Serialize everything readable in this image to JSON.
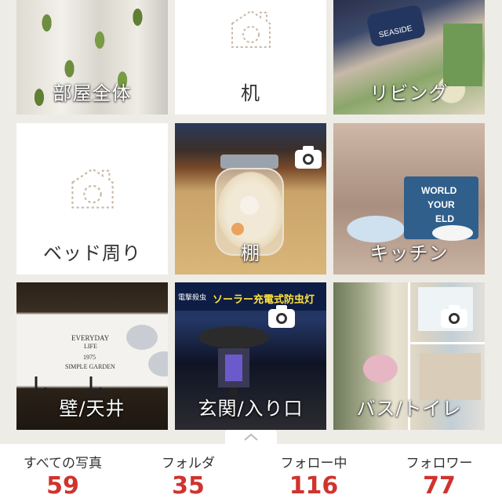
{
  "folders": [
    {
      "label": "部屋全体",
      "photo": true,
      "icon": "photo"
    },
    {
      "label": "机",
      "photo": false,
      "icon": "placeholder-camera-icon"
    },
    {
      "label": "リビング",
      "photo": true,
      "icon": "photo"
    },
    {
      "label": "ベッド周り",
      "photo": false,
      "icon": "placeholder-camera-icon"
    },
    {
      "label": "棚",
      "photo": true,
      "icon": "camera-icon"
    },
    {
      "label": "キッチン",
      "photo": true,
      "icon": "photo"
    },
    {
      "label": "壁/天井",
      "photo": true,
      "icon": "photo"
    },
    {
      "label": "玄関/入り口",
      "photo": true,
      "icon": "camera-icon"
    },
    {
      "label": "バス/トイレ",
      "photo": true,
      "icon": "camera-icon"
    }
  ],
  "photo_text": {
    "pillow": "SEASIDE",
    "sign_line1": "WORLD",
    "sign_line2": "YOUR",
    "sign_line3": "ELD",
    "hook_board_top": "EVERYDAY",
    "hook_board_top2": "LIFE",
    "hook_board_year": "1975",
    "hook_board_bottom": "SIMPLE GARDEN",
    "product_title": "ソーラー充電式防虫灯",
    "product_side": "電撃殺虫"
  },
  "stats": [
    {
      "name": "すべての写真",
      "value": "59"
    },
    {
      "name": "フォルダ",
      "value": "35"
    },
    {
      "name": "フォロー中",
      "value": "116"
    },
    {
      "name": "フォロワー",
      "value": "77"
    }
  ],
  "colors": {
    "background": "#eeece6",
    "stat_number": "#d0332e",
    "tile_label": "#ffffff"
  }
}
